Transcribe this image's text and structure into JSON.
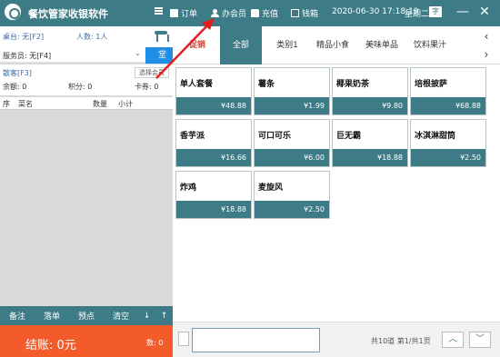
{
  "header": {
    "title": "餐饮管家收银软件",
    "order_label": "订单",
    "member_label": "办会员",
    "recharge_label": "充值",
    "cashbox_label": "钱箱",
    "datetime": "2020-06-30 17:18:19",
    "weekday": "星期二",
    "lang_badge": "字",
    "minimize": "—",
    "close": "✕"
  },
  "left": {
    "table_label": "桌台: 无[F2]",
    "people_label": "人数: 1人",
    "waiter_label": "服务员: 无[F4]",
    "side_button": "堂",
    "customer_label": "散客[F3]",
    "select_member": "选择会员",
    "balance_label": "余额: 0",
    "points_label": "积分: 0",
    "coupon_label": "卡券: 0",
    "columns": [
      "序",
      "菜名",
      "数量",
      "小计"
    ],
    "actions": [
      "备注",
      "落单",
      "预点",
      "清空",
      "↓",
      "↑"
    ],
    "checkout": "结账: 0元",
    "count": "数: 0"
  },
  "tabs": {
    "promo": "促销",
    "items": [
      "全部",
      "类别1",
      "精品小食",
      "美味单品",
      "饮料果汁"
    ],
    "active_index": 0
  },
  "products": [
    {
      "name": "单人套餐",
      "price": "¥48.88"
    },
    {
      "name": "薯条",
      "price": "¥1.99"
    },
    {
      "name": "椰果奶茶",
      "price": "¥9.80"
    },
    {
      "name": "培根披萨",
      "price": "¥68.88"
    },
    {
      "name": "香芋派",
      "price": "¥16.66"
    },
    {
      "name": "可口可乐",
      "price": "¥6.00"
    },
    {
      "name": "巨无霸",
      "price": "¥18.88"
    },
    {
      "name": "冰淇淋甜筒",
      "price": "¥2.50"
    },
    {
      "name": "炸鸡",
      "price": "¥18.88"
    },
    {
      "name": "麦旋风",
      "price": "¥2.50"
    }
  ],
  "bottom": {
    "search_value": "",
    "page_info": "共10道 第1/共1页",
    "up": "︿",
    "down": "﹀"
  },
  "colors": {
    "brand": "#3d7b87",
    "checkout": "#f35b2a",
    "promo": "#e03b2a",
    "accent_blue": "#1f8ee6",
    "annotation": "#e02020"
  }
}
